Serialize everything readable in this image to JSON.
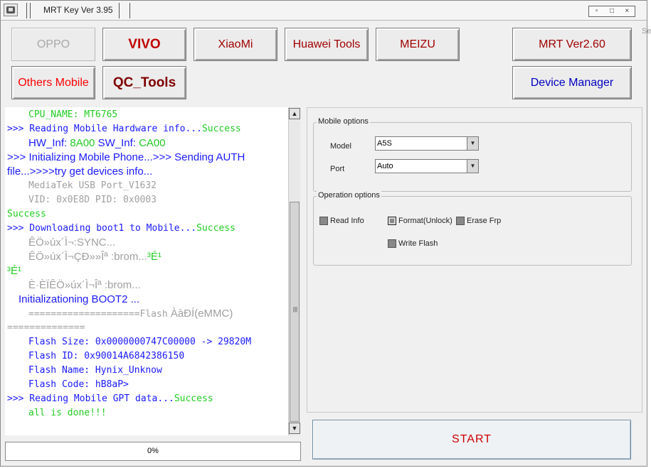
{
  "window": {
    "title": "MRT Key Ver 3.95",
    "controls": [
      "▫",
      "□",
      "×"
    ]
  },
  "ghost_text": "Set",
  "brand_buttons": {
    "oppo": {
      "label": "OPPO",
      "color": "#a8a8a8",
      "enabled": false
    },
    "vivo": {
      "label": "VIVO",
      "color": "#c00000"
    },
    "xiaomi": {
      "label": "XiaoMi",
      "color": "#a00000"
    },
    "huawei": {
      "label": "Huawei Tools",
      "color": "#a00000"
    },
    "meizu": {
      "label": "MEIZU",
      "color": "#a00000"
    },
    "mrt": {
      "label": "MRT Ver2.60",
      "color": "#a00000"
    },
    "others": {
      "label": "Others Mobile",
      "color": "#ff0000"
    },
    "qc": {
      "label": "QC_Tools",
      "color": "#800000"
    },
    "devmgr": {
      "label": "Device Manager",
      "color": "#0000c0"
    }
  },
  "log": {
    "lines": [
      {
        "font": "mono",
        "indent": 30,
        "parts": [
          {
            "t": "CPU_NAME: MT6765",
            "c": "#22cc22"
          }
        ]
      },
      {
        "font": "mono",
        "indent": 0,
        "parts": [
          {
            "t": ">>> Reading Mobile Hardware info...",
            "c": "#1a1aff"
          },
          {
            "t": "Success",
            "c": "#22cc22"
          }
        ]
      },
      {
        "font": "sans",
        "indent": 30,
        "parts": [
          {
            "t": "HW_Inf: ",
            "c": "#1a1aff"
          },
          {
            "t": "8A00",
            "c": "#22cc22"
          },
          {
            "t": "   SW_Inf: ",
            "c": "#1a1aff"
          },
          {
            "t": "CA00",
            "c": "#22cc22"
          }
        ]
      },
      {
        "font": "sans",
        "indent": 0,
        "parts": [
          {
            "t": ">>> Initializing Mobile Phone...>>> Sending AUTH",
            "c": "#1a1aff"
          }
        ]
      },
      {
        "font": "sans",
        "indent": 0,
        "parts": [
          {
            "t": "file...>>>>try get devices info...",
            "c": "#1a1aff"
          }
        ]
      },
      {
        "font": "mono",
        "indent": 30,
        "parts": [
          {
            "t": "MediaTek USB Port_V1632",
            "c": "#a0a0a0"
          }
        ]
      },
      {
        "font": "mono",
        "indent": 30,
        "parts": [
          {
            "t": "VID:  0x0E8D  PID: 0x0003",
            "c": "#a0a0a0"
          }
        ]
      },
      {
        "font": "mono",
        "indent": 0,
        "parts": [
          {
            "t": "Success",
            "c": "#22cc22"
          }
        ]
      },
      {
        "font": "mono",
        "indent": 0,
        "parts": [
          {
            "t": ">>> Downloading boot1 to Mobile...",
            "c": "#1a1aff"
          },
          {
            "t": "Success",
            "c": "#22cc22"
          }
        ]
      },
      {
        "font": "sans",
        "indent": 30,
        "parts": [
          {
            "t": "ÊÖ»úx´Ì¬:SYNC...",
            "c": "#a0a0a0"
          }
        ]
      },
      {
        "font": "sans",
        "indent": 30,
        "parts": [
          {
            "t": "ÊÖ»úx´Ì¬ÇÐ»»Îª :brom...",
            "c": "#a0a0a0"
          },
          {
            "t": "³É¹",
            "c": "#22cc22"
          }
        ]
      },
      {
        "font": "sans",
        "indent": 0,
        "parts": [
          {
            "t": "³É¹",
            "c": "#22cc22"
          }
        ]
      },
      {
        "font": "sans",
        "indent": 30,
        "parts": [
          {
            "t": "È·ÈÏÊÖ»úx´Ì¬Îª :brom...",
            "c": "#a0a0a0"
          }
        ]
      },
      {
        "font": "sans",
        "indent": 16,
        "parts": [
          {
            "t": "Initializationing BOOT2 ...",
            "c": "#1a1aff"
          }
        ]
      },
      {
        "font": "mono",
        "indent": 30,
        "parts": [
          {
            "t": "====================Flash",
            "c": "#a0a0a0"
          },
          {
            "t": " ÀàÐÍ(eMMC)",
            "c": "#a0a0a0",
            "font": "sans"
          }
        ]
      },
      {
        "font": "mono",
        "indent": 0,
        "parts": [
          {
            "t": "==============",
            "c": "#a0a0a0"
          }
        ]
      },
      {
        "font": "mono",
        "indent": 30,
        "parts": [
          {
            "t": "Flash Size: 0x0000000747C00000 -> 29820M",
            "c": "#1a1aff"
          }
        ]
      },
      {
        "font": "mono",
        "indent": 30,
        "parts": [
          {
            "t": "Flash  ID: 0x90014A6842386150",
            "c": "#1a1aff"
          }
        ]
      },
      {
        "font": "mono",
        "indent": 30,
        "parts": [
          {
            "t": "Flash Name: Hynix_Unknow",
            "c": "#1a1aff"
          }
        ]
      },
      {
        "font": "mono",
        "indent": 30,
        "parts": [
          {
            "t": "Flash Code: hB8aP>",
            "c": "#1a1aff"
          }
        ]
      },
      {
        "font": "mono",
        "indent": 0,
        "parts": [
          {
            "t": ">>> Reading Mobile GPT data...",
            "c": "#1a1aff"
          },
          {
            "t": "Success",
            "c": "#22cc22"
          }
        ]
      },
      {
        "font": "mono",
        "indent": 30,
        "parts": [
          {
            "t": "all is done!!!",
            "c": "#22cc22"
          }
        ]
      }
    ]
  },
  "progress": {
    "text": "0%",
    "value": 0
  },
  "mobile_options": {
    "label": "Mobile options",
    "model_label": "Model",
    "model_value": "A5S",
    "port_label": "Port",
    "port_value": "Auto"
  },
  "operation_options": {
    "label": "Operation options",
    "read_info": "Read Info",
    "format_unlock": "Format(Unlock)",
    "erase_frp": "Erase Frp",
    "write_flash": "Write Flash"
  },
  "start_label": "START"
}
